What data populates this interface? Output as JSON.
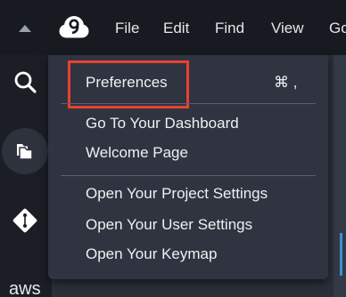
{
  "menubar": {
    "items": [
      "File",
      "Edit",
      "Find",
      "View",
      "Go"
    ]
  },
  "sidebar": {
    "bottom_label": "aws"
  },
  "dropdown": {
    "items": [
      {
        "label": "Preferences",
        "shortcut": "⌘ ,"
      },
      {
        "label": "Go To Your Dashboard"
      },
      {
        "label": "Welcome Page"
      },
      {
        "label": "Open Your Project Settings"
      },
      {
        "label": "Open Your User Settings"
      },
      {
        "label": "Open Your Keymap"
      }
    ]
  },
  "colors": {
    "highlight": "#e8412e",
    "menu_background": "#2f3440",
    "menubar_background": "#171a20"
  },
  "icons": [
    "triangle-up-icon",
    "cloud9-logo-icon",
    "search-icon",
    "files-icon",
    "git-icon"
  ]
}
